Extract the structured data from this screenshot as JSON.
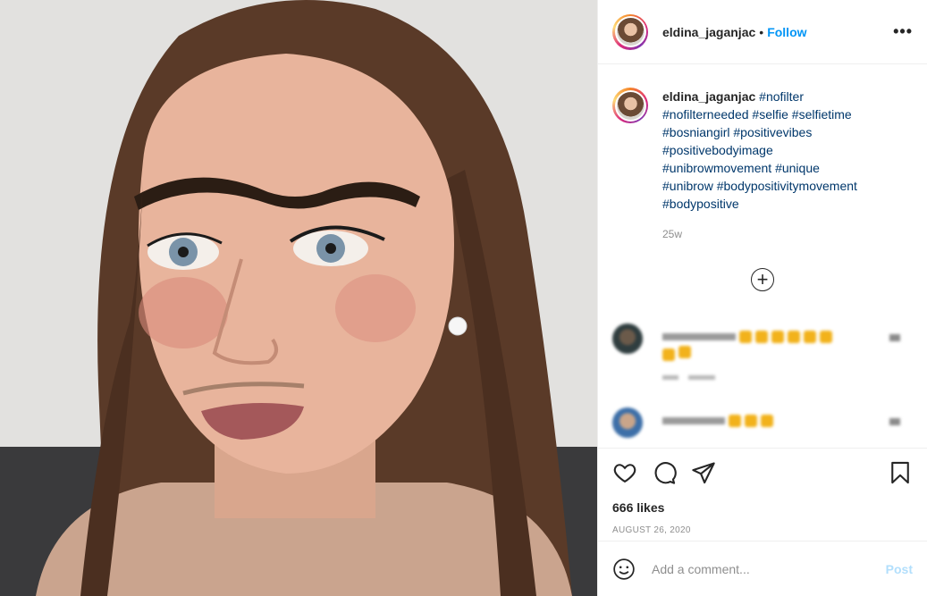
{
  "post": {
    "username": "eldina_jaganjac",
    "separator": "•",
    "follow_label": "Follow",
    "more_label": "•••",
    "photo_subject": "selfie-photo"
  },
  "caption": {
    "username": "eldina_jaganjac",
    "hashtags": [
      "#nofilter",
      "#nofilterneeded",
      "#selfie",
      "#selfietime",
      "#bosniangirl",
      "#positivevibes",
      "#positivebodyimage",
      "#unibrowmovement",
      "#unique",
      "#unibrow",
      "#bodypositivitymovement",
      "#bodypositive"
    ],
    "age": "25w"
  },
  "load_more_label": "+",
  "actions": {
    "likes": "666 likes",
    "date": "AUGUST 26, 2020"
  },
  "add_comment": {
    "placeholder": "Add a comment...",
    "post_label": "Post"
  },
  "colors": {
    "accent": "#0095f6",
    "hashtag": "#00376b",
    "muted": "#8e8e8e",
    "post_disabled": "#b2dffc"
  }
}
